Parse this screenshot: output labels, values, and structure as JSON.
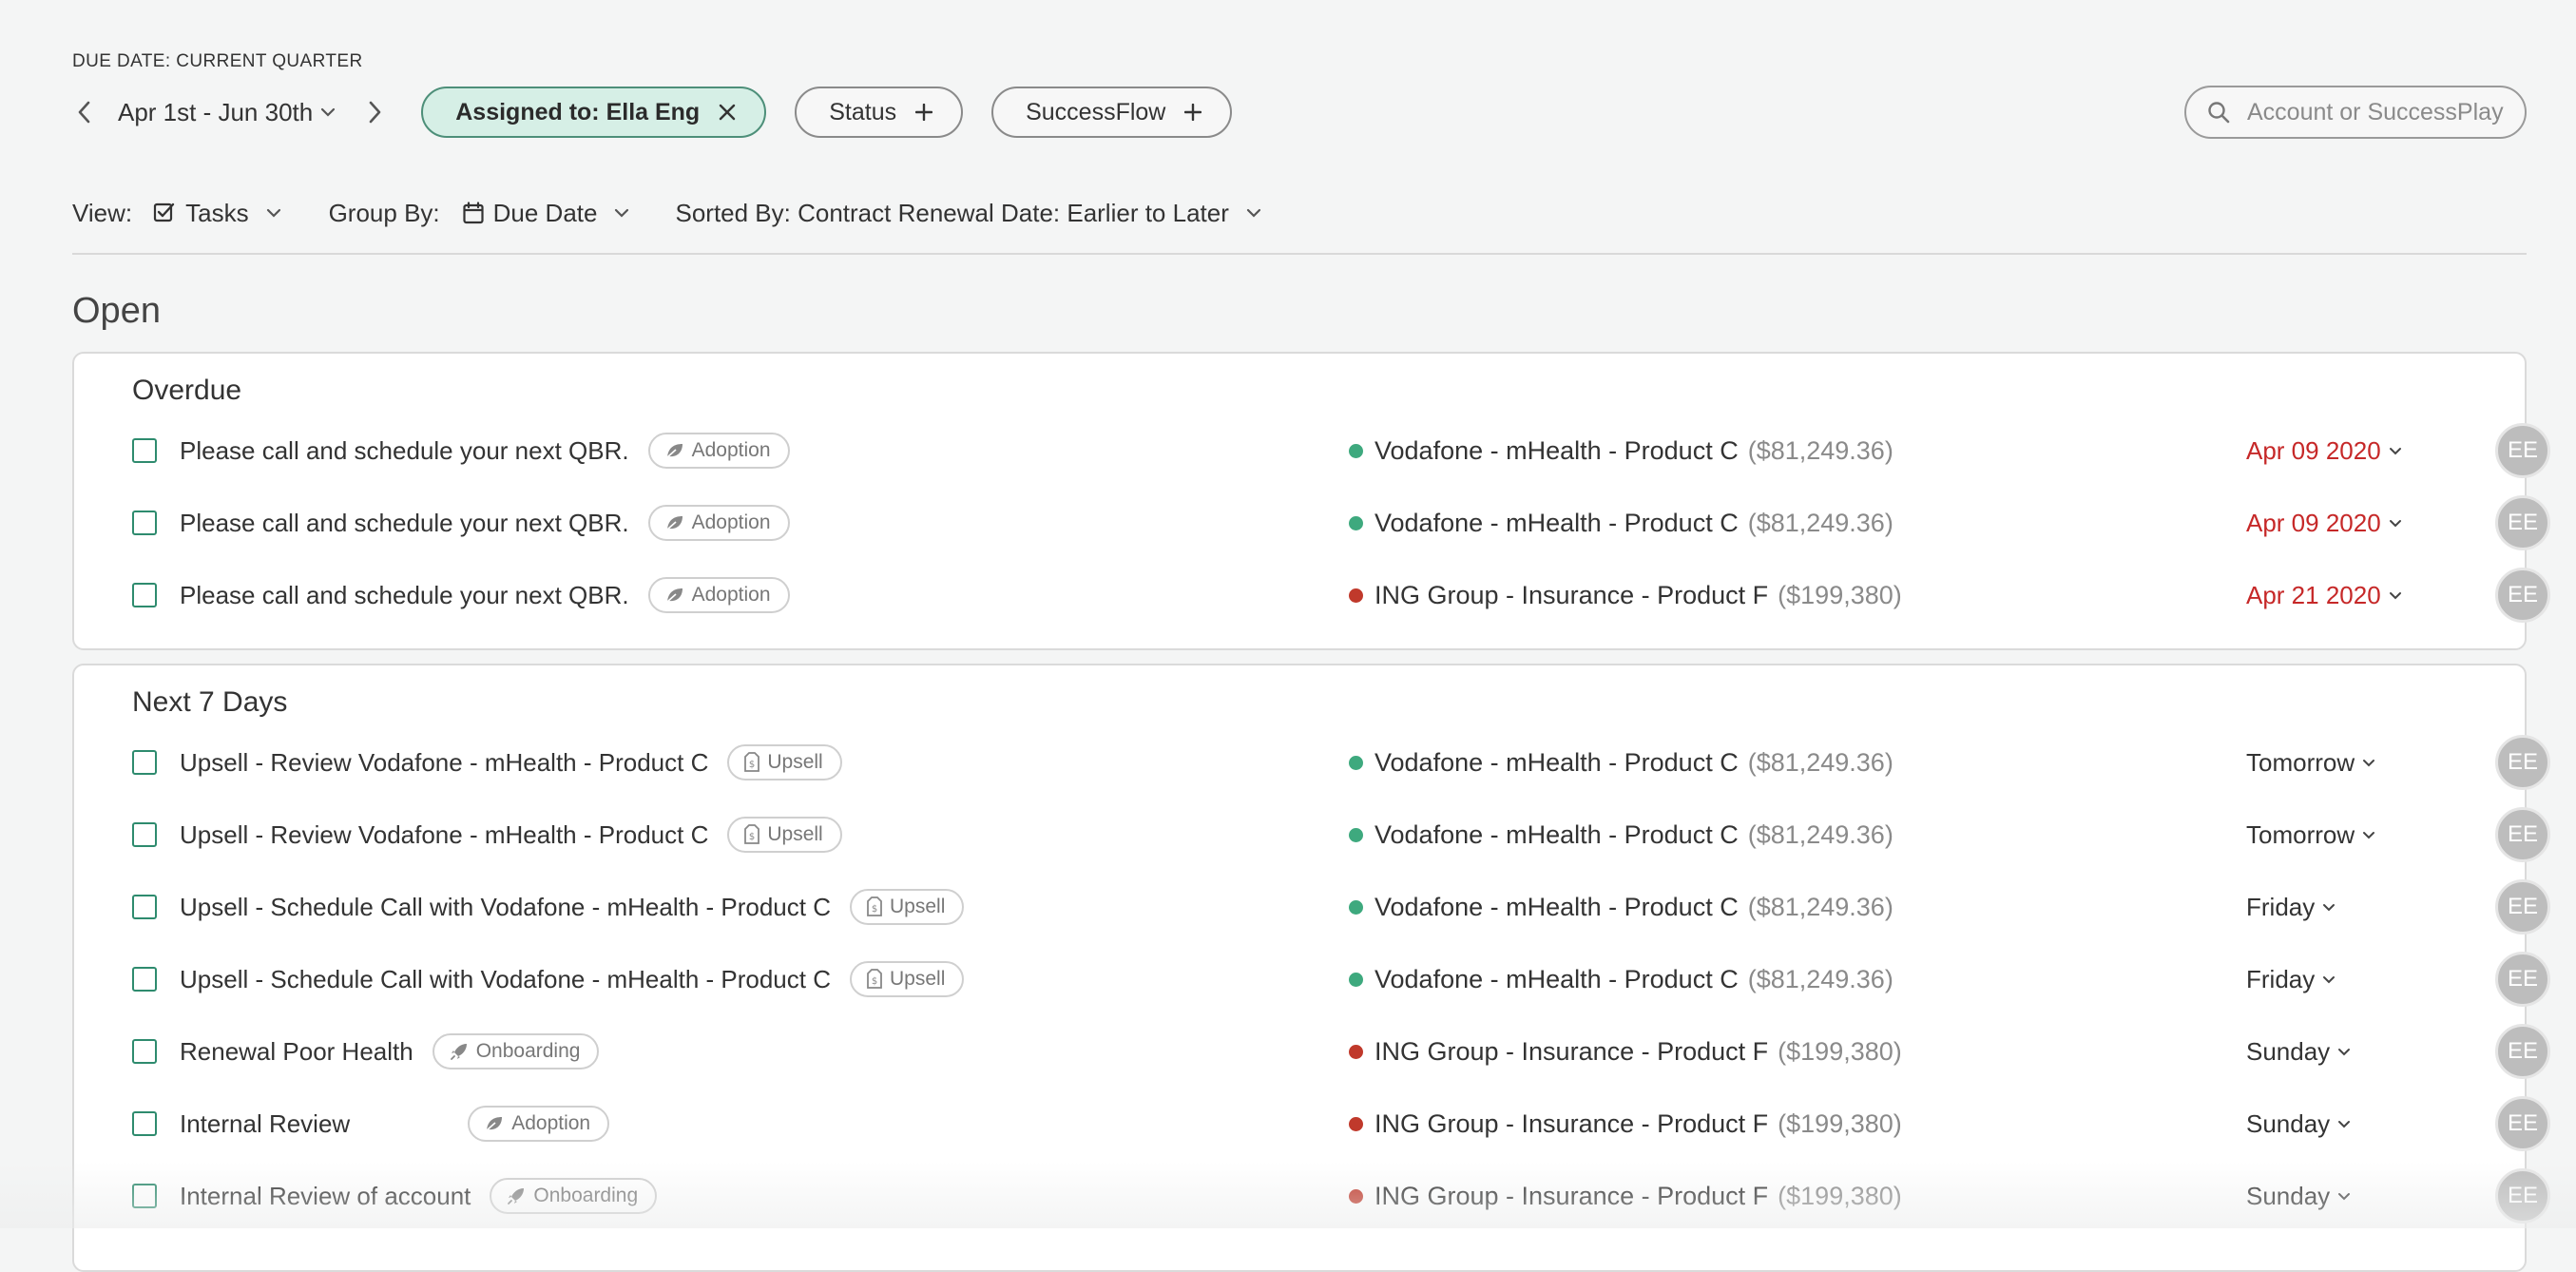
{
  "filters": {
    "due_label": "DUE DATE: CURRENT QUARTER",
    "date_range": "Apr 1st - Jun 30th",
    "assigned_pill": "Assigned to: Ella Eng",
    "status_pill": "Status",
    "successflow_pill": "SuccessFlow",
    "search_placeholder": "Account or SuccessPlay"
  },
  "toolbar": {
    "view_label": "View:",
    "view_value": "Tasks",
    "group_label": "Group By:",
    "group_value": "Due Date",
    "sort_value": "Sorted By: Contract Renewal Date: Earlier to Later"
  },
  "section_title": "Open",
  "colors": {
    "green_dot": "#3ea97e",
    "red_dot": "#c0392b",
    "overdue": "#c62828",
    "accent": "#2e8b6e"
  },
  "groups": [
    {
      "title": "Overdue",
      "tasks": [
        {
          "name": "Please call and schedule your next QBR.",
          "tag": "Adoption",
          "tag_icon": "leaf-icon",
          "account": "Vodafone - mHealth - Product C",
          "amount": "($81,249.36)",
          "health": "green",
          "due": "Apr 09 2020",
          "overdue": true,
          "assignee": "EE"
        },
        {
          "name": "Please call and schedule your next QBR.",
          "tag": "Adoption",
          "tag_icon": "leaf-icon",
          "account": "Vodafone - mHealth - Product C",
          "amount": "($81,249.36)",
          "health": "green",
          "due": "Apr 09 2020",
          "overdue": true,
          "assignee": "EE"
        },
        {
          "name": "Please call and schedule your next QBR.",
          "tag": "Adoption",
          "tag_icon": "leaf-icon",
          "account": "ING Group - Insurance - Product F",
          "amount": "($199,380)",
          "health": "red",
          "due": "Apr 21 2020",
          "overdue": true,
          "assignee": "EE"
        }
      ]
    },
    {
      "title": "Next 7 Days",
      "tasks": [
        {
          "name": "Upsell - Review Vodafone - mHealth - Product C",
          "tag": "Upsell",
          "tag_icon": "price-tag-icon",
          "account": "Vodafone - mHealth - Product C",
          "amount": "($81,249.36)",
          "health": "green",
          "due": "Tomorrow",
          "overdue": false,
          "assignee": "EE"
        },
        {
          "name": "Upsell - Review Vodafone - mHealth - Product C",
          "tag": "Upsell",
          "tag_icon": "price-tag-icon",
          "account": "Vodafone - mHealth - Product C",
          "amount": "($81,249.36)",
          "health": "green",
          "due": "Tomorrow",
          "overdue": false,
          "assignee": "EE"
        },
        {
          "name": "Upsell - Schedule Call with Vodafone - mHealth - Product C",
          "tag": "Upsell",
          "tag_icon": "price-tag-icon",
          "account": "Vodafone - mHealth - Product C",
          "amount": "($81,249.36)",
          "health": "green",
          "due": "Friday",
          "overdue": false,
          "assignee": "EE"
        },
        {
          "name": "Upsell - Schedule Call with Vodafone - mHealth - Product C",
          "tag": "Upsell",
          "tag_icon": "price-tag-icon",
          "account": "Vodafone - mHealth - Product C",
          "amount": "($81,249.36)",
          "health": "green",
          "due": "Friday",
          "overdue": false,
          "assignee": "EE"
        },
        {
          "name": "Renewal Poor Health",
          "tag": "Onboarding",
          "tag_icon": "rocket-icon",
          "account": "ING Group - Insurance - Product F",
          "amount": "($199,380)",
          "health": "red",
          "due": "Sunday",
          "overdue": false,
          "assignee": "EE"
        },
        {
          "name": "Internal Review",
          "tag": "Adoption",
          "tag_icon": "leaf-icon",
          "account": "ING Group - Insurance - Product F",
          "amount": "($199,380)",
          "health": "red",
          "due": "Sunday",
          "overdue": false,
          "assignee": "EE"
        },
        {
          "name": "Internal Review of account",
          "tag": "Onboarding",
          "tag_icon": "rocket-icon",
          "account": "ING Group - Insurance - Product F",
          "amount": "($199,380)",
          "health": "red",
          "due": "Sunday",
          "overdue": false,
          "assignee": "EE"
        }
      ]
    }
  ]
}
